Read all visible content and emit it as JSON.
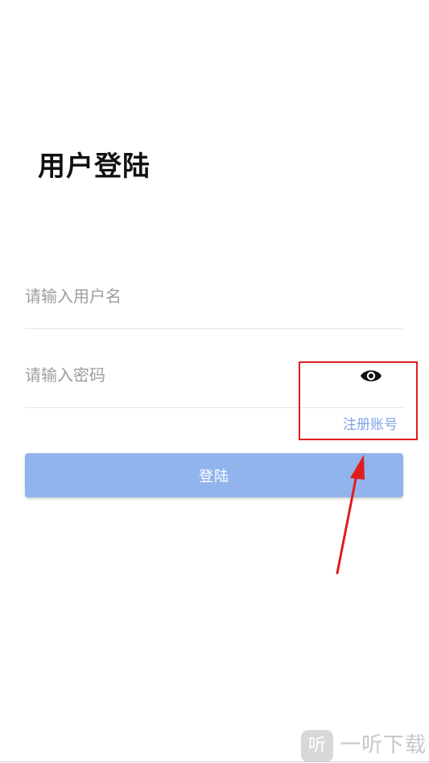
{
  "header": {
    "title": "用户登陆"
  },
  "form": {
    "username_placeholder": "请输入用户名",
    "username_value": "",
    "password_placeholder": "请输入密码",
    "password_value": "",
    "password_toggle_icon": "eye-icon",
    "register_label": "注册账号",
    "login_label": "登陆"
  },
  "watermark": {
    "logo_text": "听",
    "text": "一听下载"
  },
  "colors": {
    "primary": "#92b4ed",
    "link": "#7ea2e6",
    "annotation": "#e01c1c",
    "placeholder": "#9e9e9e"
  }
}
